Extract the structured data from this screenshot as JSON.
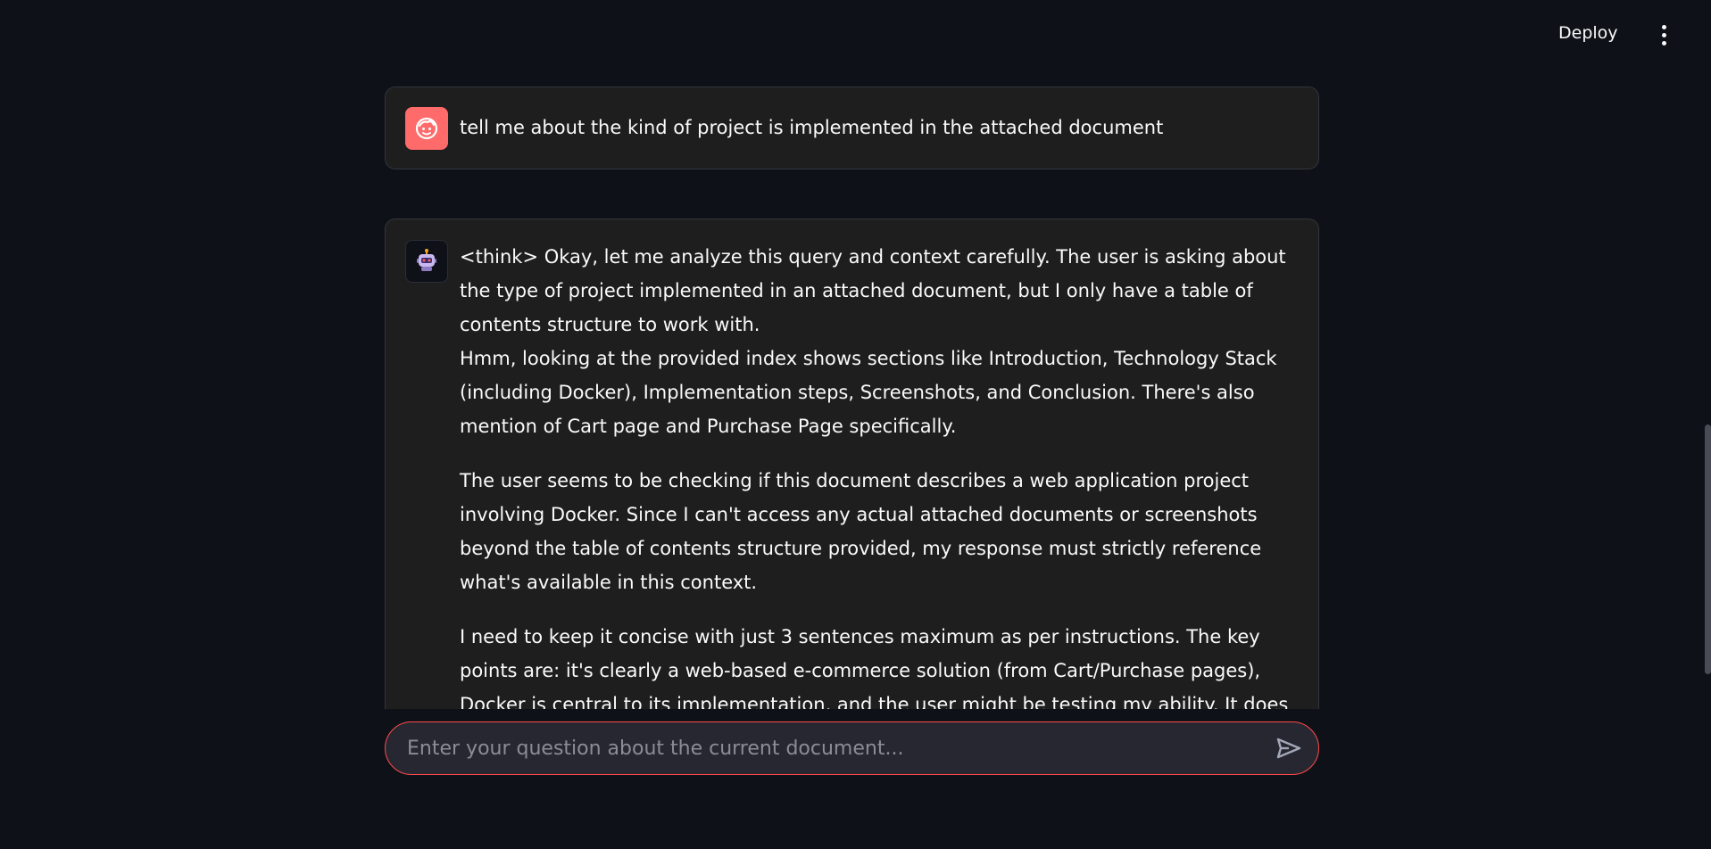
{
  "header": {
    "deploy_label": "Deploy",
    "menu_icon": "kebab-menu-icon"
  },
  "chat": {
    "messages": [
      {
        "role": "user",
        "avatar_icon": "user-face-icon",
        "text": "tell me about the kind of project is implemented in the attached document"
      },
      {
        "role": "assistant",
        "avatar_icon": "robot-icon",
        "paragraphs": [
          "<think> Okay, let me analyze this query and context carefully. The user is asking about the type of project implemented in an attached document, but I only have a table of contents structure to work with.",
          "Hmm, looking at the provided index shows sections like Introduction, Technology Stack (including Docker), Implementation steps, Screenshots, and Conclusion. There's also mention of Cart page and Purchase Page specifically.",
          "The user seems to be checking if this document describes a web application project involving Docker. Since I can't access any actual attached documents or screenshots beyond the table of contents structure provided, my response must strictly reference what's available in this context.",
          "I need to keep it concise with just 3 sentences maximum as per instructions. The key points are: it's clearly a web-based e-commerce solution (from Cart/Purchase pages), Docker is central to its implementation, and the user might be testing my ability. It does seem to acknowledge..."
        ]
      }
    ]
  },
  "input": {
    "placeholder": "Enter your question about the current document...",
    "value": "",
    "send_icon": "send-icon"
  },
  "colors": {
    "background": "#0e1117",
    "message_bg": "#1e1e1e",
    "user_avatar": "#ff6b6b",
    "input_border": "#ff4b4b"
  }
}
